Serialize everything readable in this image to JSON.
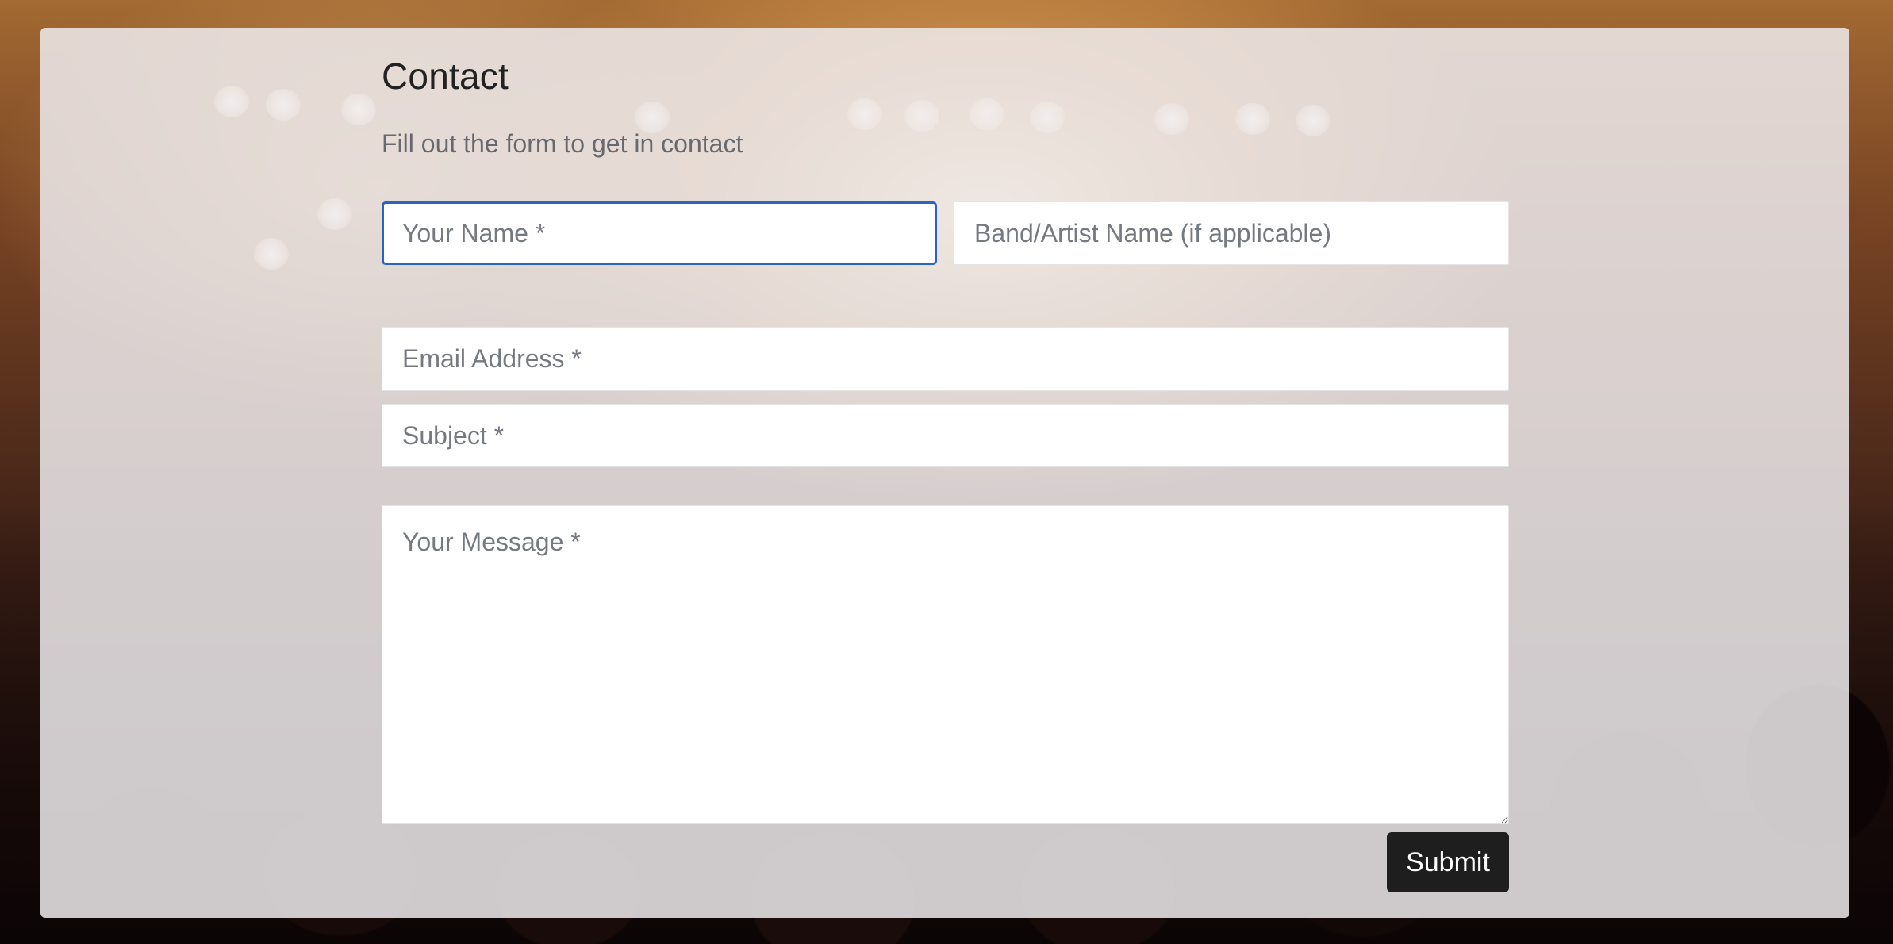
{
  "page": {
    "title": "Contact",
    "subtitle": "Fill out the form to get in contact"
  },
  "form": {
    "name": {
      "placeholder": "Your Name *",
      "value": "",
      "focused": true
    },
    "band": {
      "placeholder": "Band/Artist Name (if applicable)",
      "value": ""
    },
    "email": {
      "placeholder": "Email Address *",
      "value": ""
    },
    "subject": {
      "placeholder": "Subject *",
      "value": ""
    },
    "message": {
      "placeholder": "Your Message *",
      "value": ""
    },
    "submit_label": "Submit"
  },
  "colors": {
    "focus_border": "#2a63c4",
    "button_background": "#1e1e1e",
    "card_background": "#eeeaec"
  }
}
